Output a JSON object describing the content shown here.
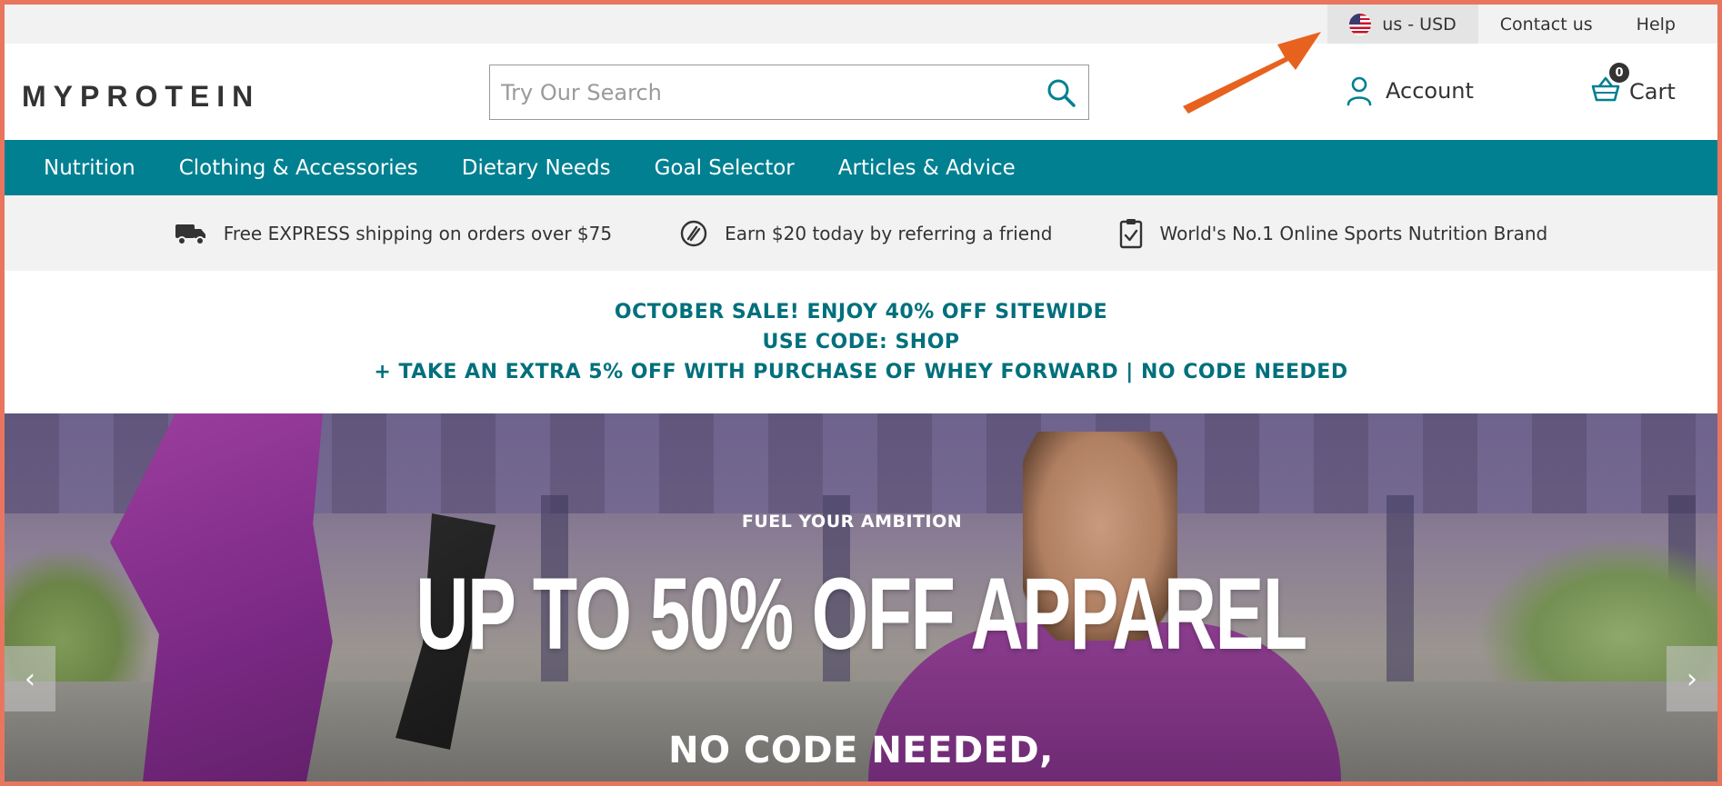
{
  "utility_bar": {
    "locale_label": "us - USD",
    "contact_label": "Contact us",
    "help_label": "Help"
  },
  "header": {
    "logo_text": "MYPROTEIN",
    "search_placeholder": "Try Our Search",
    "account_label": "Account",
    "cart_label": "Cart",
    "cart_count": "0"
  },
  "nav": {
    "items": [
      {
        "label": "Nutrition"
      },
      {
        "label": "Clothing & Accessories"
      },
      {
        "label": "Dietary Needs"
      },
      {
        "label": "Goal Selector"
      },
      {
        "label": "Articles & Advice"
      }
    ]
  },
  "usp": {
    "items": [
      {
        "icon": "truck-icon",
        "text": "Free EXPRESS shipping on orders over $75"
      },
      {
        "icon": "referral-icon",
        "text": "Earn $20 today by referring a friend"
      },
      {
        "icon": "clipboard-check-icon",
        "text": "World's No.1 Online Sports Nutrition Brand"
      }
    ]
  },
  "promo": {
    "line1": "OCTOBER SALE! ENJOY 40% OFF SITEWIDE",
    "line2": "USE CODE: SHOP",
    "line3": "+ TAKE AN EXTRA 5% OFF WITH PURCHASE OF WHEY FORWARD | NO CODE NEEDED"
  },
  "hero": {
    "eyebrow": "FUEL YOUR AMBITION",
    "headline": "UP TO 50% OFF APPAREL",
    "subheadline": "NO CODE NEEDED,",
    "prev_label": "‹",
    "next_label": "›"
  },
  "colors": {
    "brand_teal": "#008091",
    "promo_teal": "#00707c",
    "annotation_orange": "#e8621f"
  }
}
